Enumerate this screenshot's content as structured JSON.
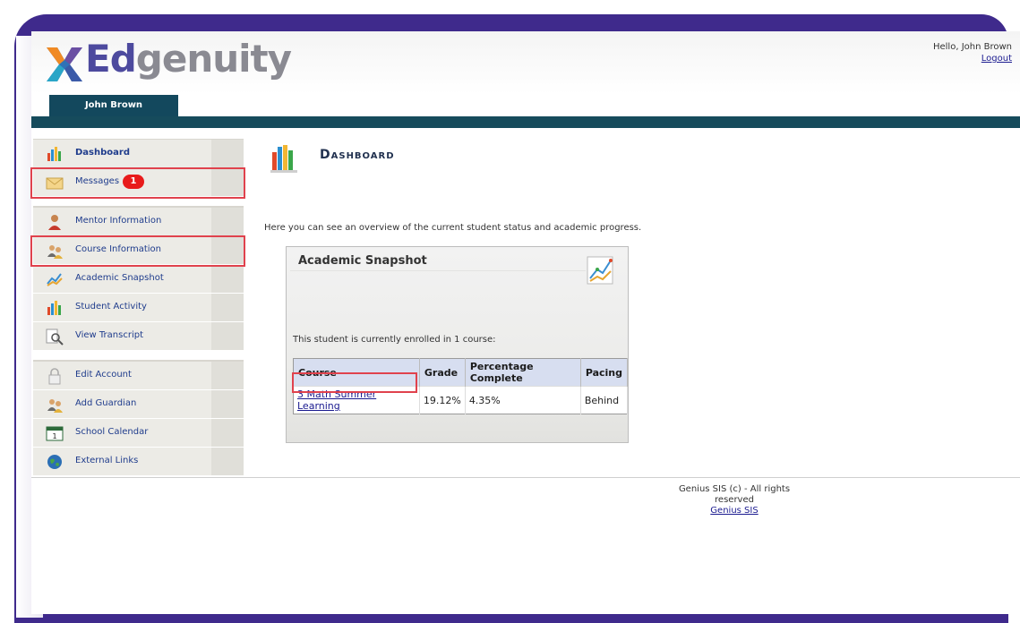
{
  "app": {
    "logo_text_a": "Ed",
    "logo_text_b": "genuity"
  },
  "header": {
    "greeting": "Hello, John Brown",
    "logout": "Logout",
    "user_tab": "John Brown"
  },
  "sidebar": {
    "items": [
      {
        "label": "Dashboard",
        "icon": "chart-bars-icon"
      },
      {
        "label": "Messages",
        "icon": "envelope-icon",
        "badge": "1"
      },
      {
        "label": "Mentor Information",
        "icon": "mentor-person-icon"
      },
      {
        "label": "Course Information",
        "icon": "people-icon"
      },
      {
        "label": "Academic Snapshot",
        "icon": "line-chart-icon"
      },
      {
        "label": "Student Activity",
        "icon": "chart-bars-icon"
      },
      {
        "label": "View Transcript",
        "icon": "magnifier-icon"
      },
      {
        "label": "Edit Account",
        "icon": "lock-icon"
      },
      {
        "label": "Add Guardian",
        "icon": "people-icon"
      },
      {
        "label": "School Calendar",
        "icon": "calendar-icon"
      },
      {
        "label": "External Links",
        "icon": "globe-icon"
      }
    ],
    "calendar_day": "1"
  },
  "main": {
    "title": "Dashboard",
    "intro": "Here you can see an overview of the current student status and academic progress.",
    "snapshot": {
      "title": "Academic Snapshot",
      "enrolled": "This student is currently enrolled in 1 course:",
      "columns": [
        "Course",
        "Grade",
        "Percentage Complete",
        "Pacing"
      ],
      "rows": [
        {
          "course": "3 Math Summer Learning",
          "grade": "19.12%",
          "complete": "4.35%",
          "pacing": "Behind"
        }
      ]
    }
  },
  "footer": {
    "copyright": "Genius SIS (c) - All rights reserved",
    "link": "Genius SIS"
  },
  "colors": {
    "accent": "#13485d",
    "highlight": "#e0424d",
    "badge": "#e81b1b",
    "link": "#1f3c8c"
  }
}
